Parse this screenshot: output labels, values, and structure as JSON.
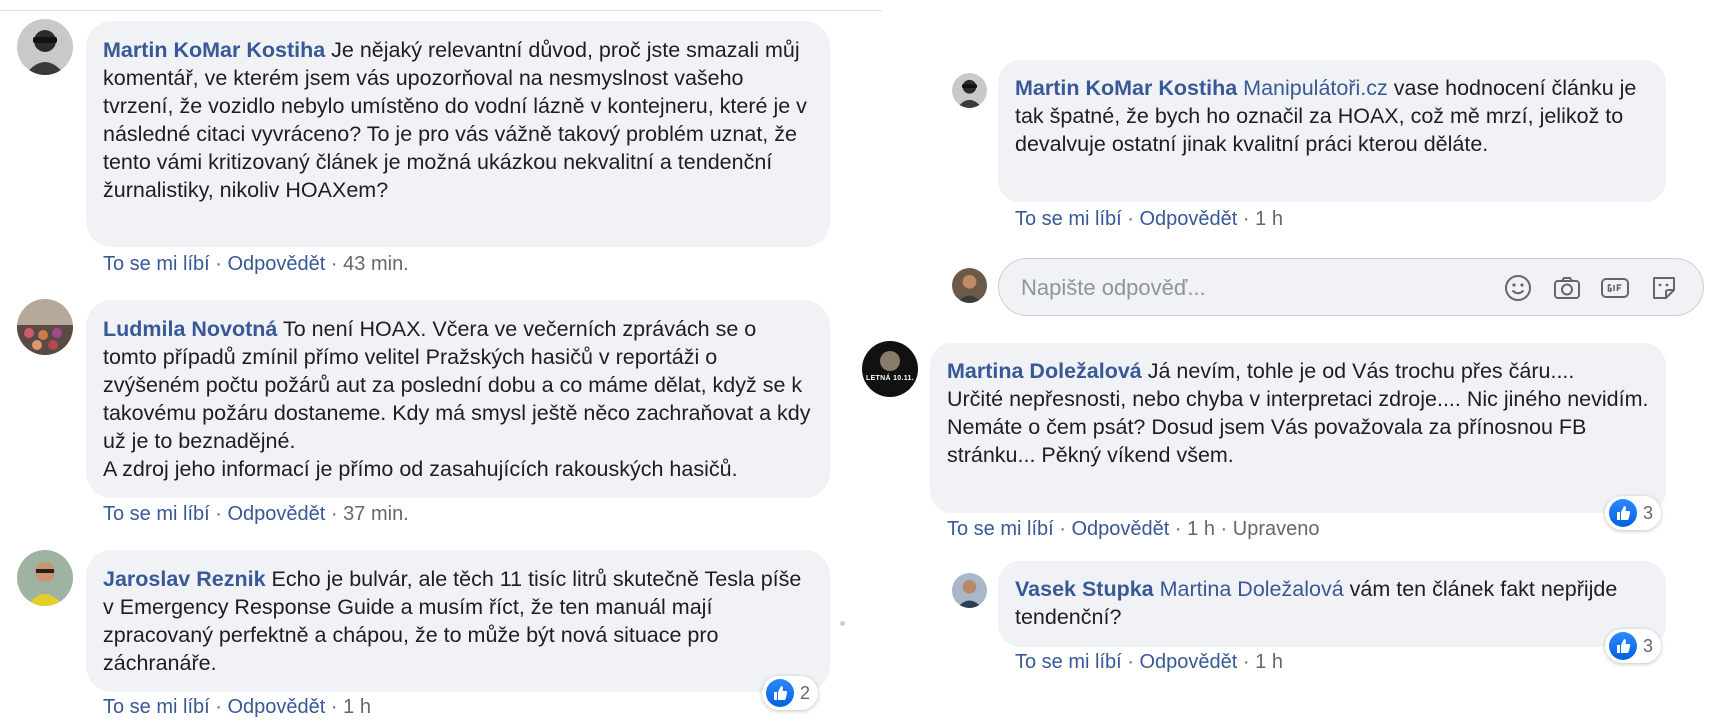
{
  "ui": {
    "like_label": "To se mi líbí",
    "reply_label": "Odpovědět",
    "separator": "·"
  },
  "colors": {
    "author_blue": "#385898",
    "bubble_bg": "#f0f2f5",
    "meta_gray": "#65676b",
    "like_blue": "#1877f2"
  },
  "left_comments": [
    {
      "author": "Martin KoMar Kostiha",
      "text": "Je nějaký relevantní důvod, proč jste smazali můj komentář, ve kterém jsem vás upozorňoval na nesmyslnost vašeho tvrzení, že vozidlo nebylo umístěno do vodní lázně v kontejneru, které je v následné citaci vyvráceno? To je pro vás vážně takový problém uznat, že tento vámi kritizovaný článek je možná ukázkou nekvalitní a tendenční žurnalistiky, nikoliv HOAXem?",
      "time": "43 min.",
      "avatar_icon": "avatar-photo"
    },
    {
      "author": "Ludmila Novotná",
      "text": "To není HOAX. Včera ve večerních zprávách se o tomto případů zmínil přímo velitel Pražských hasičů v reportáži o zvýšeném počtu požárů aut za poslední dobu a co máme dělat, když se k takovému požáru dostaneme. Kdy má smysl ještě něco zachraňovat a kdy už je to beznadějné.\nA zdroj jeho informací je přímo od zasahujících rakouských hasičů.",
      "time": "37 min.",
      "avatar_icon": "avatar-photo"
    },
    {
      "author": "Jaroslav Reznik",
      "text": "Echo je bulvár, ale těch 11 tisíc litrů skutečně Tesla píše v Emergency Response Guide a musím říct, že ten manuál mají zpracovaný perfektně a chápou, že to může být nová situace pro záchranáře.",
      "time": "1 h",
      "reactions": "2",
      "avatar_icon": "avatar-photo"
    }
  ],
  "right_comments": [
    {
      "author": "Martin KoMar Kostiha",
      "mention": "Manipulátoři.cz",
      "text": "vase hodnocení článku je tak špatné, že bych ho označil za HOAX, což mě mrzí, jelikož to devalvuje ostatní jinak kvalitní práci kterou děláte.",
      "time": "1 h"
    },
    {
      "author": "Martina Doležalová",
      "text": "Já nevím, tohle je od Vás trochu přes čáru....\nUrčité nepřesnosti, nebo chyba v interpretaci zdroje.... Nic jiného nevidím.\nNemáte o čem psát? Dosud jsem Vás považovala za přínosnou FB stránku... Pěkný víkend všem.",
      "time": "1 h",
      "edited": "Upraveno",
      "reactions": "3",
      "avatar_text": "LETNÁ 10.11."
    },
    {
      "author": "Vasek Stupka",
      "mention": "Martina Doležalová",
      "text": "vám ten článek fakt nepřijde tendenční?",
      "time": "1 h",
      "reactions": "3"
    }
  ],
  "reply_box": {
    "placeholder": "Napište odpověď...",
    "icons": [
      "emoji-icon",
      "camera-icon",
      "gif-icon",
      "sticker-icon"
    ]
  }
}
